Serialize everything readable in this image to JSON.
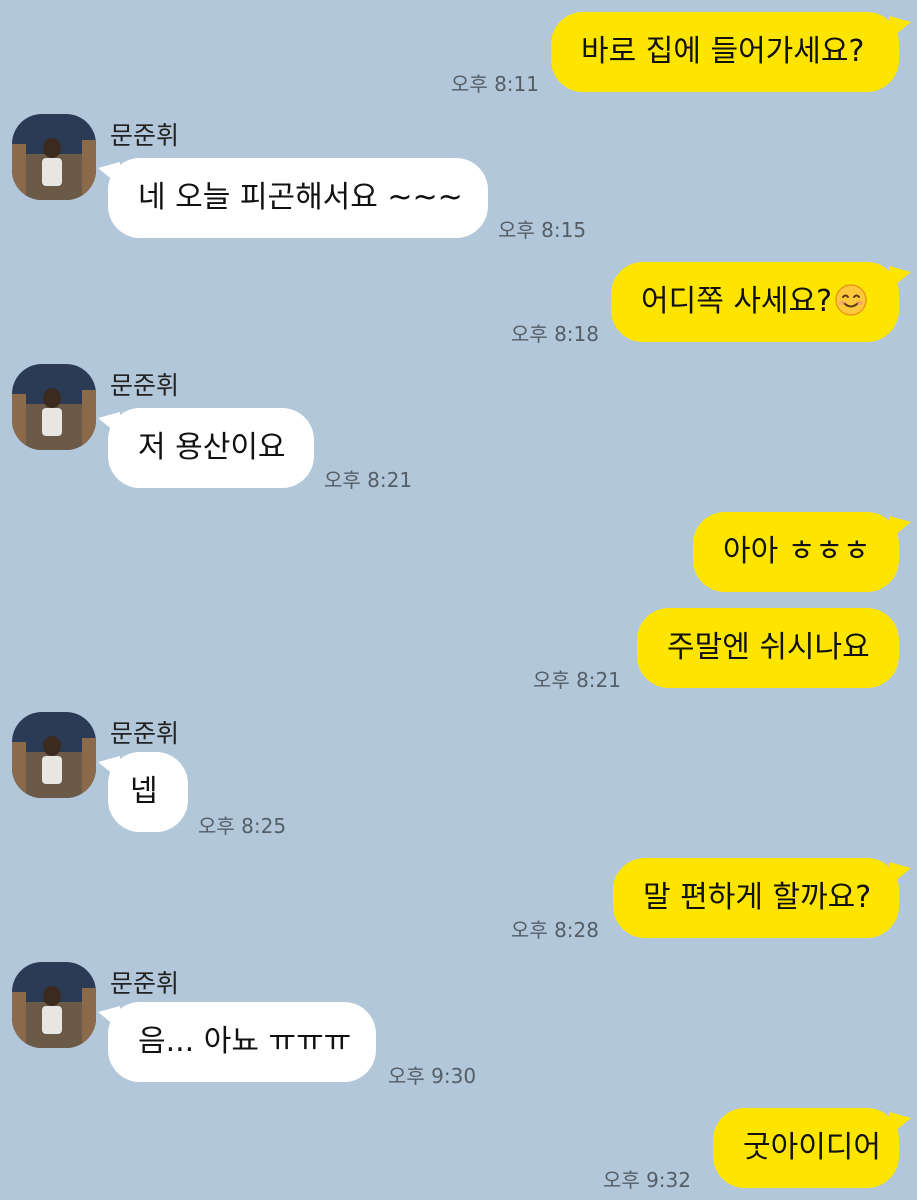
{
  "contact": {
    "name": "문준휘"
  },
  "messages": [
    {
      "from": "me",
      "text": "바로 집에 들어가세요?",
      "time": "오후 8:11"
    },
    {
      "from": "them",
      "text": "네 오늘 피곤해서요 ~~~",
      "time": "오후 8:15"
    },
    {
      "from": "me",
      "text": "어디쪽 사세요?",
      "emoji": "smiling-face-emoji",
      "time": "오후 8:18"
    },
    {
      "from": "them",
      "text": "저 용산이요",
      "time": "오후 8:21"
    },
    {
      "from": "me",
      "text": "아아 ㅎㅎㅎ"
    },
    {
      "from": "me",
      "text": "주말엔 쉬시나요",
      "time": "오후 8:21"
    },
    {
      "from": "them",
      "text": "넵",
      "time": "오후 8:25"
    },
    {
      "from": "me",
      "text": "말 편하게 할까요?",
      "time": "오후 8:28"
    },
    {
      "from": "them",
      "text": "음... 아뇨 ㅠㅠㅠ",
      "time": "오후 9:30"
    },
    {
      "from": "me",
      "text": "굿아이디어",
      "time": "오후 9:32"
    }
  ],
  "colors": {
    "background": "#b2c7d9",
    "my_bubble": "#fee500",
    "their_bubble": "#ffffff"
  }
}
